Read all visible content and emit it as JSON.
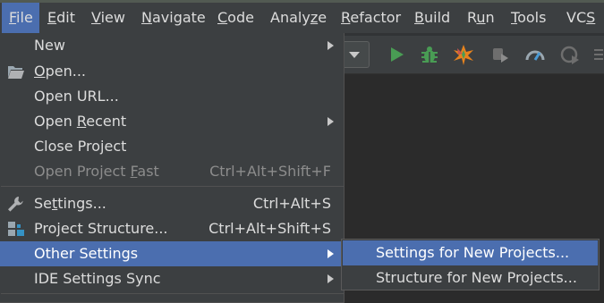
{
  "menubar": {
    "items": [
      {
        "pre": "",
        "mn": "F",
        "post": "ile"
      },
      {
        "pre": "",
        "mn": "E",
        "post": "dit"
      },
      {
        "pre": "",
        "mn": "V",
        "post": "iew"
      },
      {
        "pre": "",
        "mn": "N",
        "post": "avigate"
      },
      {
        "pre": "",
        "mn": "C",
        "post": "ode"
      },
      {
        "pre": "Analy",
        "mn": "z",
        "post": "e"
      },
      {
        "pre": "",
        "mn": "R",
        "post": "efactor"
      },
      {
        "pre": "",
        "mn": "B",
        "post": "uild"
      },
      {
        "pre": "R",
        "mn": "u",
        "post": "n"
      },
      {
        "pre": "",
        "mn": "T",
        "post": "ools"
      },
      {
        "pre": "VC",
        "mn": "S",
        "post": ""
      }
    ]
  },
  "toolbar": {
    "icons": [
      "run-icon",
      "debug-icon",
      "run-with-coverage-icon",
      "profile-icon",
      "analyze-performance-icon",
      "attach-debugger-icon",
      "more-icon"
    ]
  },
  "file_menu": {
    "new": {
      "label": "New"
    },
    "open": {
      "pre": "",
      "mn": "O",
      "post": "pen..."
    },
    "open_url": {
      "label": "Open URL..."
    },
    "open_recent": {
      "pre": "Open ",
      "mn": "R",
      "post": "ecent"
    },
    "close_project": {
      "label": "Close Project"
    },
    "open_project_fast": {
      "pre": "Open Project ",
      "mn": "F",
      "post": "ast",
      "shortcut": "Ctrl+Alt+Shift+F"
    },
    "settings": {
      "pre": "Se",
      "mn": "t",
      "post": "tings...",
      "shortcut": "Ctrl+Alt+S"
    },
    "project_structure": {
      "label": "Project Structure...",
      "shortcut": "Ctrl+Alt+Shift+S"
    },
    "other_settings": {
      "label": "Other Settings"
    },
    "ide_settings_sync": {
      "label": "IDE Settings Sync"
    }
  },
  "other_settings_submenu": {
    "items": [
      {
        "label": "Settings for New Projects..."
      },
      {
        "label": "Structure for New Projects..."
      }
    ]
  },
  "colors": {
    "accent": "#4b6eaf",
    "menu_bg": "#3c3f41",
    "editor_bg": "#2b2b2b",
    "run_green": "#499c54"
  }
}
